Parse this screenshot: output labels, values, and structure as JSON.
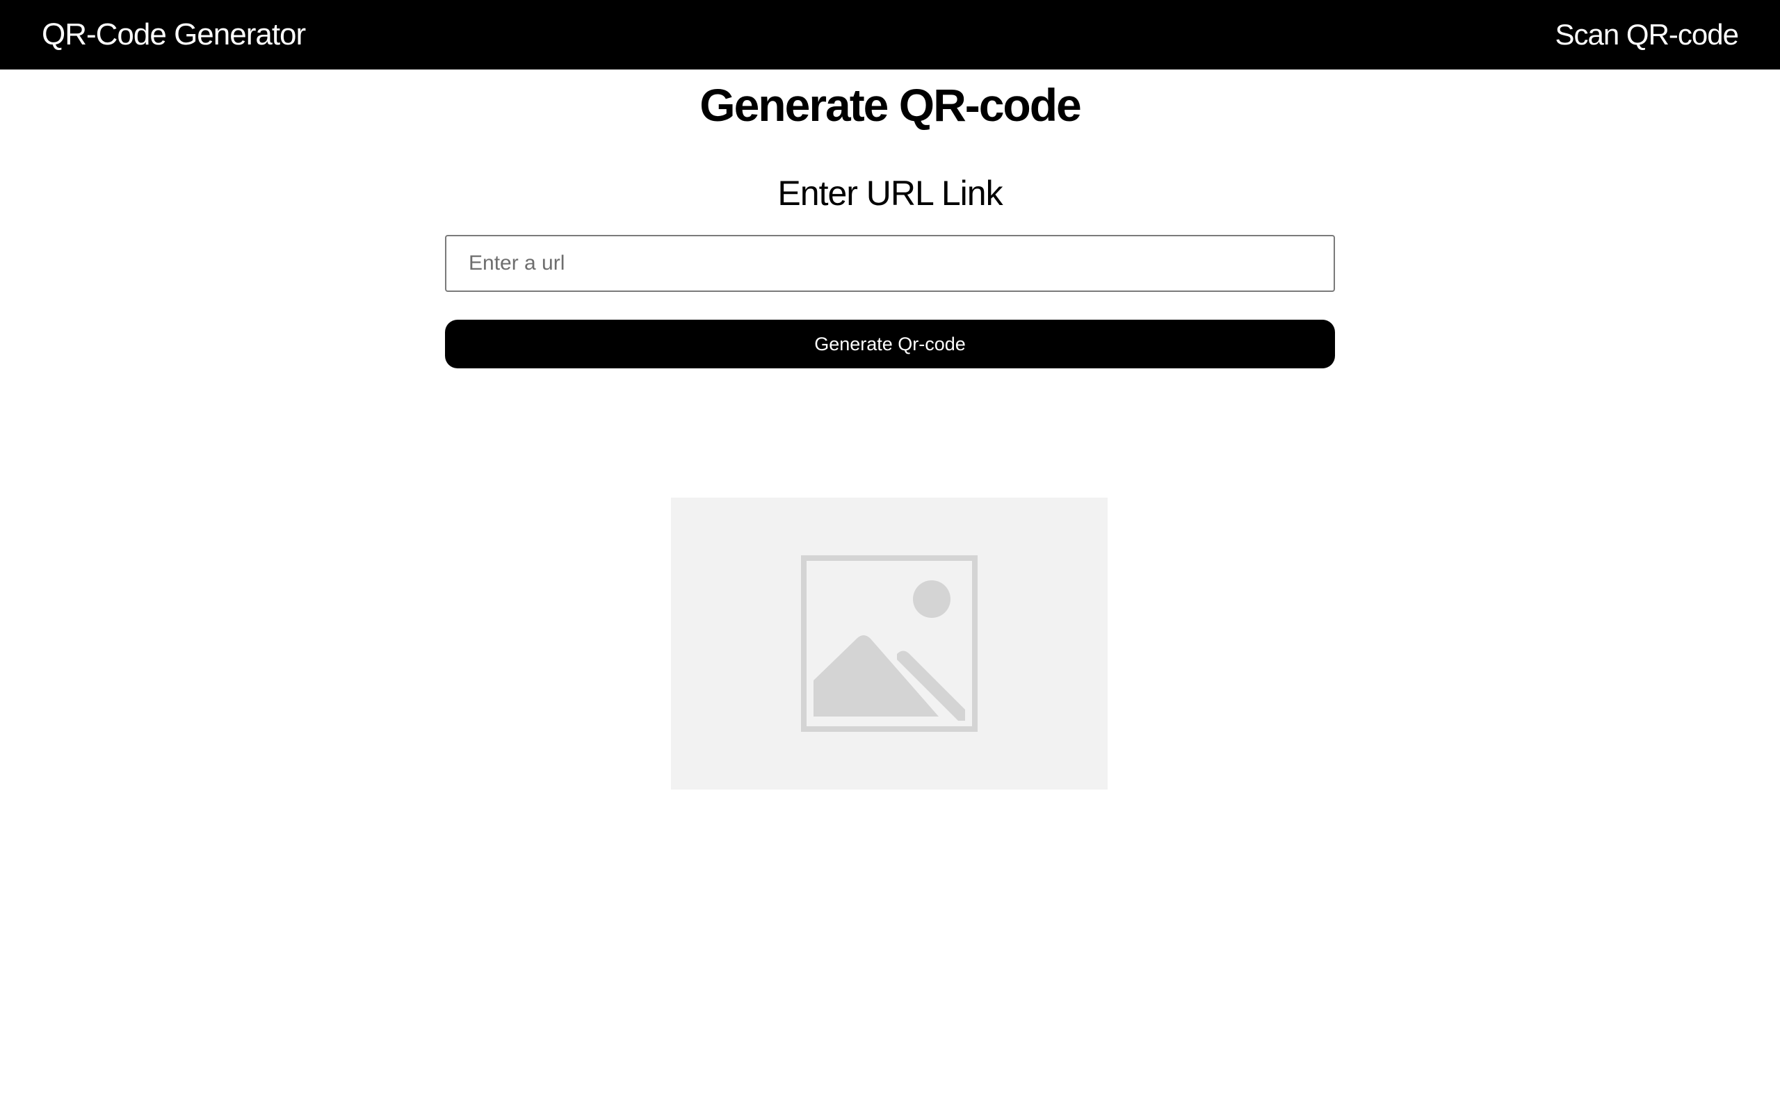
{
  "header": {
    "brand": "QR-Code Generator",
    "nav_link": "Scan QR-code"
  },
  "main": {
    "title": "Generate QR-code",
    "input_label": "Enter URL Link",
    "url_input": {
      "value": "",
      "placeholder": "Enter a url"
    },
    "generate_button": "Generate Qr-code",
    "qr_output": {
      "icon": "image-placeholder-icon"
    }
  },
  "colors": {
    "header_bg": "#000000",
    "header_text": "#ffffff",
    "button_bg": "#000000",
    "button_text": "#ffffff",
    "placeholder_bg": "#f2f2f2",
    "placeholder_icon": "#d4d4d4"
  }
}
